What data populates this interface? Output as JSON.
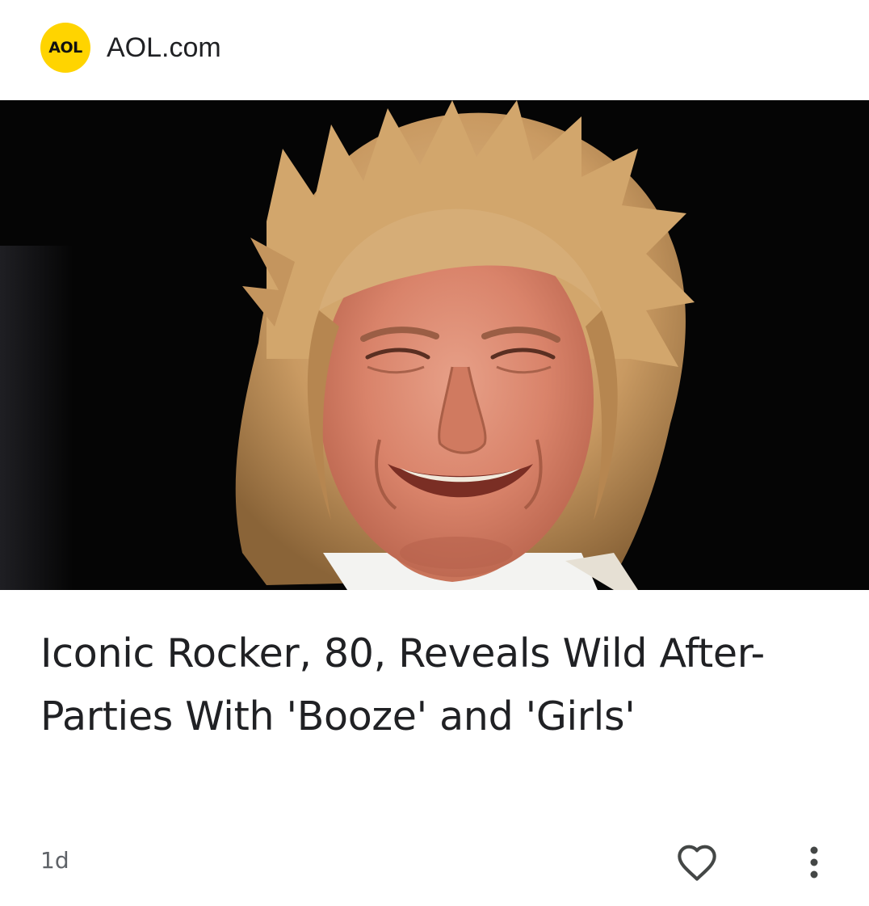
{
  "source": {
    "logo_text": "AOL",
    "name": "AOL.com",
    "logo_color": "#FFD400"
  },
  "hero_image": {
    "alt": "Smiling man with spiky blond hair against a black background"
  },
  "article": {
    "headline": "Iconic Rocker, 80, Reveals Wild After-Parties With 'Booze' and 'Girls'",
    "age": "1d"
  },
  "actions": {
    "like_icon": "heart-outline-icon",
    "more_icon": "vertical-dots-icon"
  },
  "colors": {
    "text_primary": "#202124",
    "text_secondary": "#5f6368",
    "icon": "#444746"
  }
}
